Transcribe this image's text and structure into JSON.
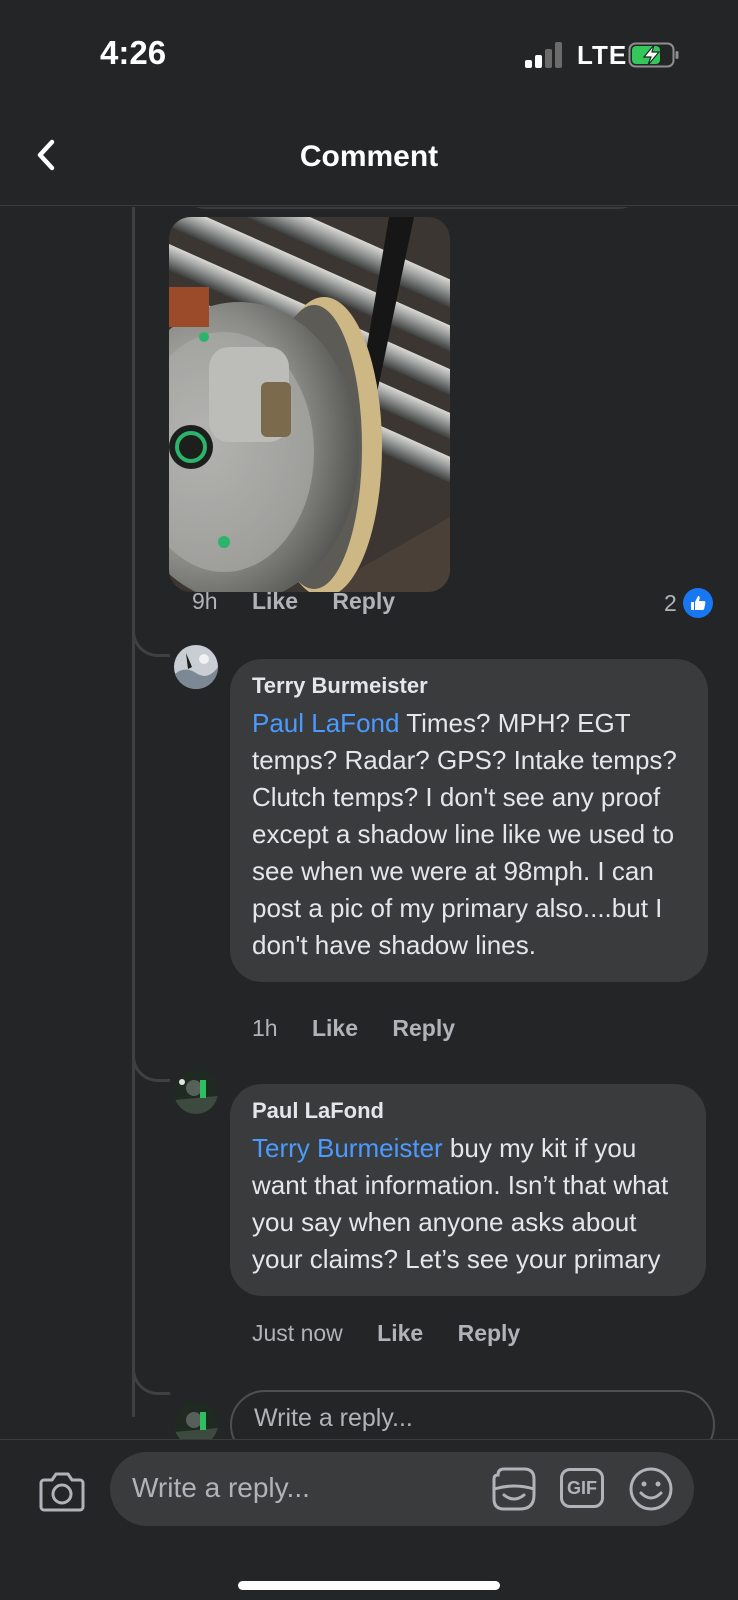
{
  "status_bar": {
    "time": "4:26",
    "carrier": "LTE",
    "battery_charging": true
  },
  "header": {
    "title": "Comment"
  },
  "thread": {
    "photo_post": {
      "age": "9h",
      "like_label": "Like",
      "reply_label": "Reply",
      "reaction_count": "2",
      "reaction_icon": "thumbs-up-icon",
      "photo_subject": "clutch-primary-photo"
    },
    "replies": [
      {
        "author": "Terry Burmeister",
        "mention": "Paul LaFond",
        "text": " Times? MPH? EGT temps? Radar? GPS? Intake temps? Clutch temps? I don't see any proof except a shadow line like we used to see when we were at 98mph. I can post a pic of my primary also....but I don't have shadow lines.",
        "age": "1h",
        "like_label": "Like",
        "reply_label": "Reply"
      },
      {
        "author": "Paul LaFond",
        "mention": "Terry Burmeister",
        "text": " buy my kit if you want that information. Isn’t that what you say when anyone asks about your claims? Let’s see your primary",
        "age": "Just now",
        "like_label": "Like",
        "reply_label": "Reply"
      }
    ],
    "inline_reply_placeholder": "Write a reply..."
  },
  "composer": {
    "placeholder": "Write a reply...",
    "gif_label": "GIF"
  },
  "colors": {
    "background": "#242526",
    "bubble": "#3a3b3c",
    "mention": "#4b9aff",
    "like_badge": "#1877f2",
    "secondary_text": "#b0b3b8"
  }
}
